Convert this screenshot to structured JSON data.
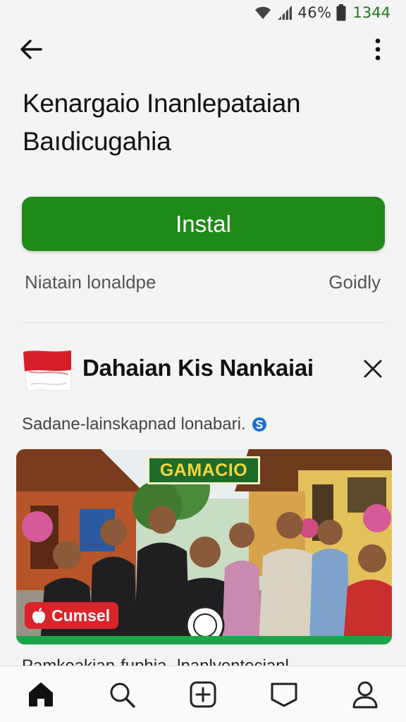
{
  "status_bar": {
    "battery_percent": "46%",
    "time": "1344",
    "icons": [
      "wifi-icon",
      "signal-icon",
      "battery-icon"
    ]
  },
  "top_bar": {
    "back_icon": "arrow-left-icon",
    "menu_icon": "more-vert-icon"
  },
  "app": {
    "title_line1": "Kenargaio Inanlepataian",
    "title_line2": "Baıdicugahia",
    "install_label": "Instal",
    "meta_left": "Niatain lonaldpe",
    "meta_right": "Goidly"
  },
  "card": {
    "title": "Dahaian Kis Nankaiai",
    "subtitle": "Sadane-lainskapnad lonabari.",
    "subtitle_icon": "dollar-badge-icon",
    "close_icon": "close-icon",
    "flag_icon": "indonesia-flag-icon",
    "banner_badge_top": "GAMACIO",
    "banner_brand": "Cumsel",
    "banner_brand_icon": "apple-icon",
    "peek_text": "Pamkeakian-fuphia -lnanlyentecianl"
  },
  "bottom_nav": {
    "items": [
      {
        "name": "home",
        "icon": "home-icon",
        "active": true
      },
      {
        "name": "search",
        "icon": "search-icon",
        "active": false
      },
      {
        "name": "add",
        "icon": "add-box-icon",
        "active": false
      },
      {
        "name": "library",
        "icon": "bookmark-icon",
        "active": false
      },
      {
        "name": "profile",
        "icon": "person-icon",
        "active": false
      }
    ]
  },
  "colors": {
    "accent_green": "#1f8a17",
    "time_green": "#1c7a1c",
    "brand_red": "#d9242a",
    "banner_bar": "#1ca44a",
    "badge_yellow": "#f5d63b"
  }
}
